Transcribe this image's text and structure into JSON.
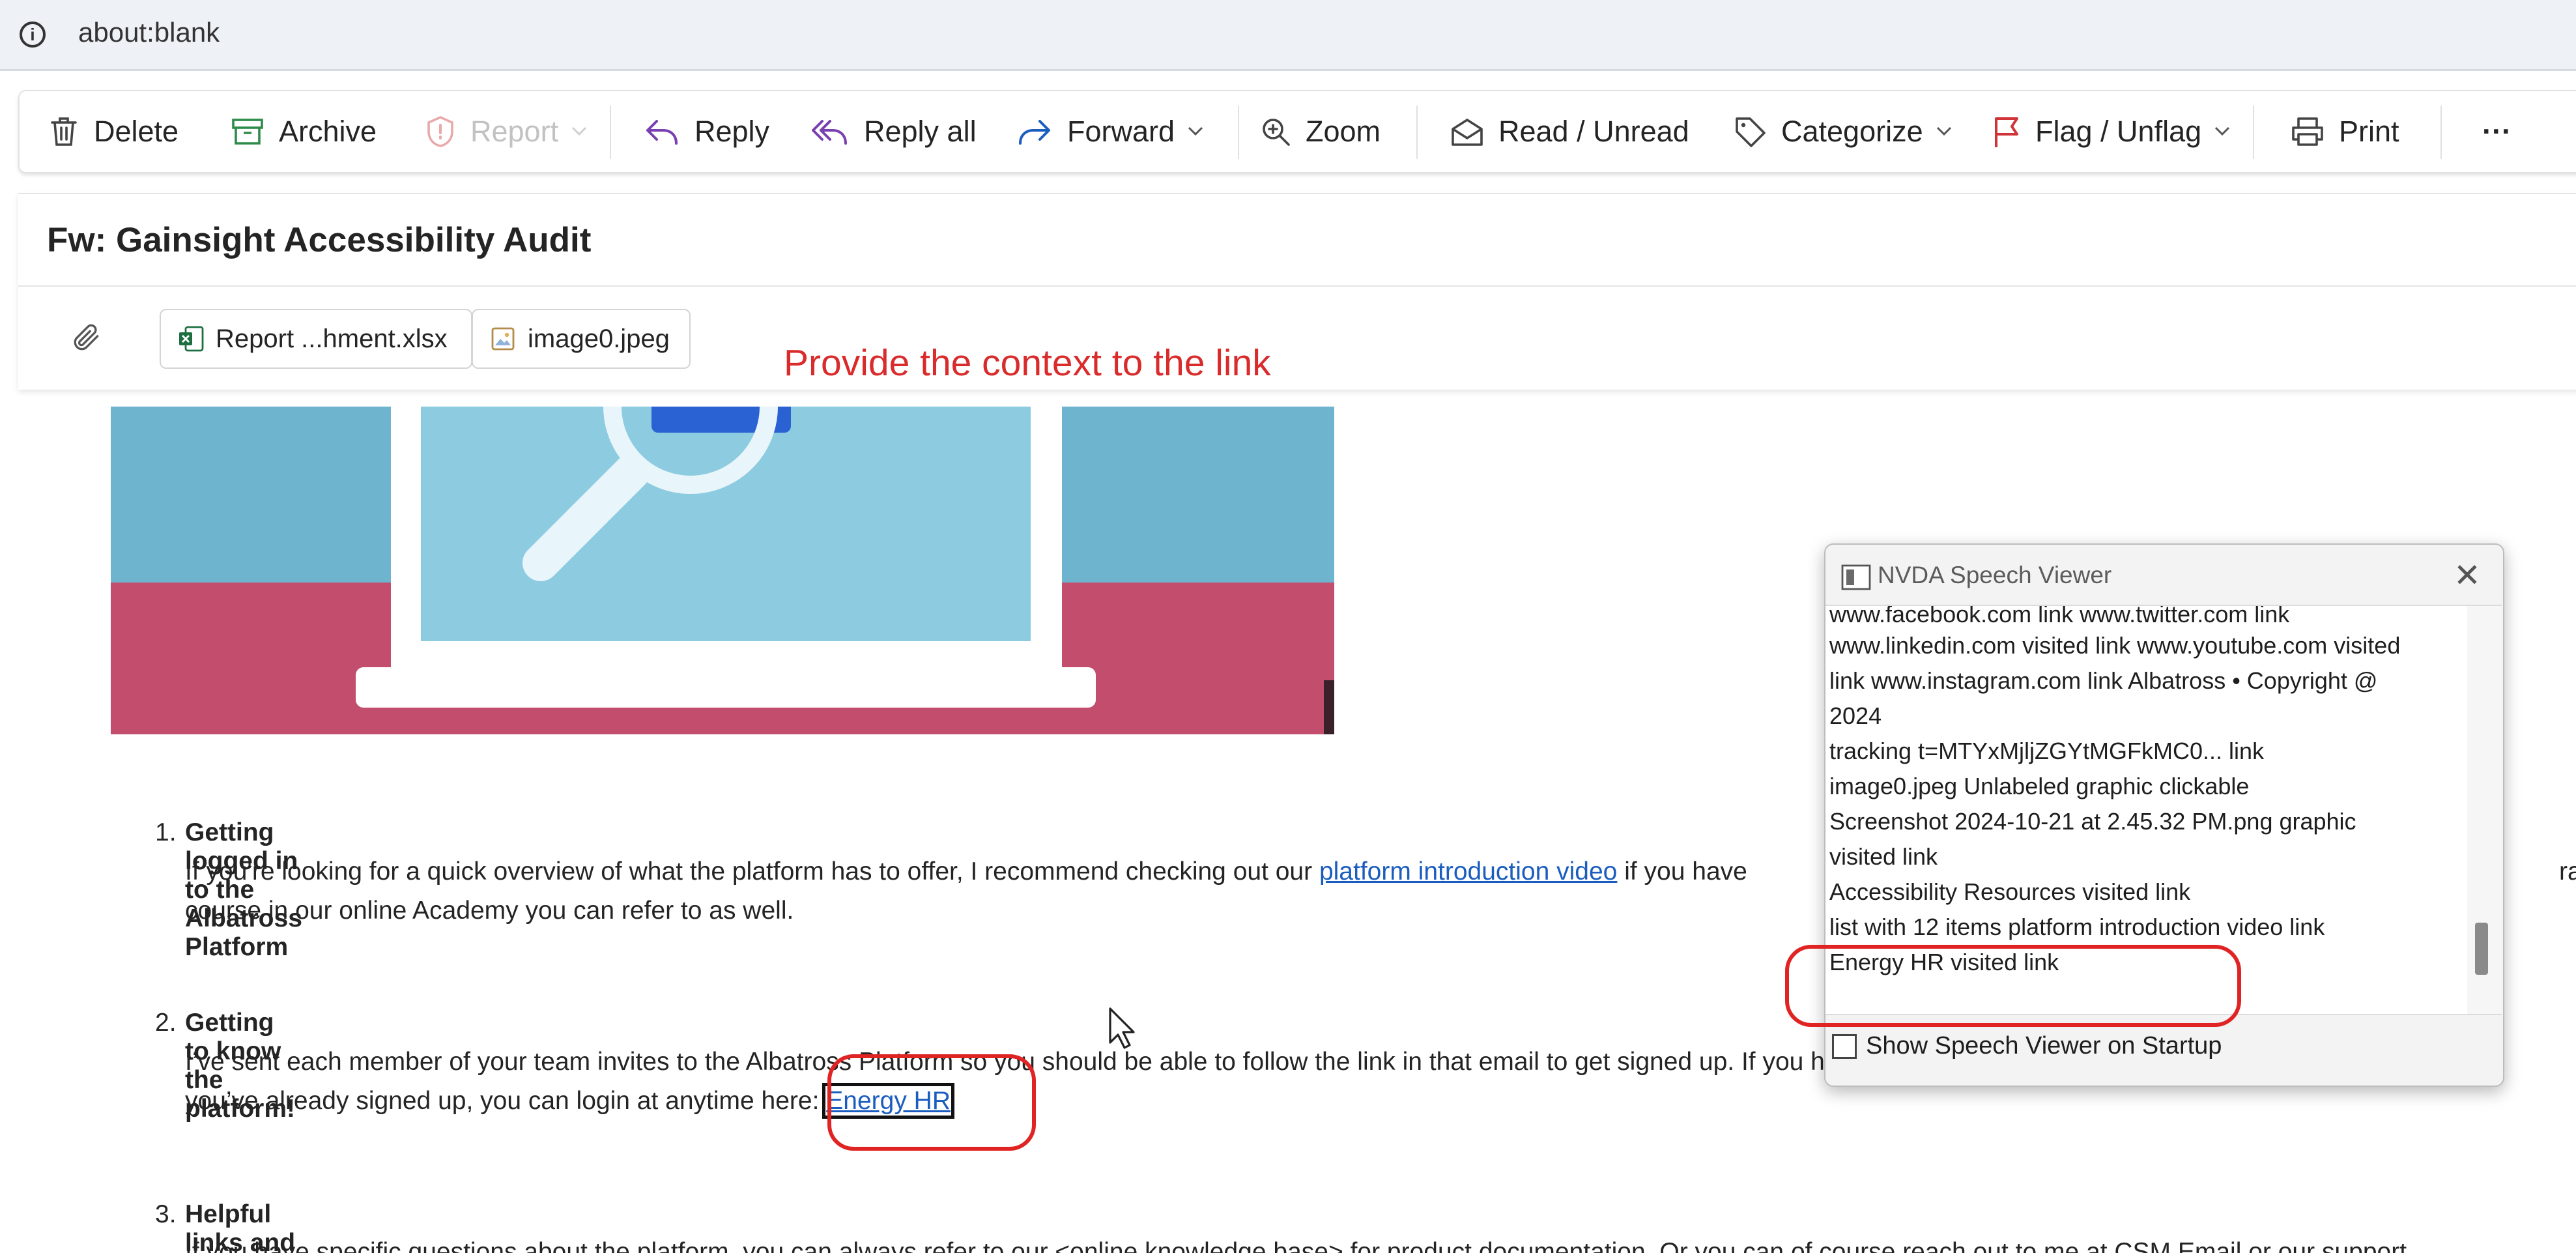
{
  "address_bar": {
    "url": "about:blank"
  },
  "toolbar": {
    "delete": "Delete",
    "archive": "Archive",
    "report": "Report",
    "reply": "Reply",
    "reply_all": "Reply all",
    "forward": "Forward",
    "zoom": "Zoom",
    "read_unread": "Read / Unread",
    "categorize": "Categorize",
    "flag_unflag": "Flag / Unflag",
    "print": "Print",
    "more": "···"
  },
  "email": {
    "subject": "Fw: Gainsight Accessibility Audit",
    "attachments": [
      {
        "name": "Report ...hment.xlsx"
      },
      {
        "name": "image0.jpeg"
      }
    ]
  },
  "annotation": {
    "note": "Provide the context to the link"
  },
  "body": {
    "items": [
      {
        "num": "1.",
        "title": "Getting logged in to the Albatross Platform",
        "line1_pre": "If you're looking for a quick overview of what the platform has to offer, I recommend checking out our ",
        "line1_link": "platform introduction video",
        "line1_post": " if you have",
        "line1_tail": "raining",
        "line2": "course in our online Academy you can refer to as well."
      },
      {
        "num": "2.",
        "title": "Getting to know the platform!",
        "line1": "I’ve sent each member of your team invites to the Albatross Platform so you should be able to follow the link in that email to get signed up. If you haven’t received an email yet, please let me know. If",
        "line2_pre": "you’ve already signed up, you can login at anytime here: ",
        "line2_link": "Energy HR"
      },
      {
        "num": "3.",
        "title": "Helpful links and resources",
        "line1": "If you have specific questions about the platform, you can always refer to our <online knowledge base> for product documentation. Or you can of course reach out to me at CSM Email or our support"
      }
    ]
  },
  "nvda": {
    "title": "NVDA Speech Viewer",
    "close": "✕",
    "lines": [
      "www.facebook.com  link   www.twitter.com  link",
      "www.linkedin.com  visited  link   www.youtube.com  visited",
      "link   www.instagram.com  link   Albatross • Copyright @",
      "2024",
      "tracking t=MTYxMjljZGYtMGFkMC0...  link",
      "image0.jpeg  Unlabeled graphic  clickable",
      "Screenshot 2024-10-21 at 2.45.32 PM.png  graphic",
      "visited  link",
      "Accessibility Resources  visited  link",
      "list  with 12 items  platform introduction video  link",
      "Energy HR  visited  link"
    ],
    "checkbox_label": "Show Speech Viewer on Startup"
  },
  "colors": {
    "annotation_red": "#e02424",
    "link_blue": "#1a5dbf",
    "hero_top": "#6fb4cf",
    "hero_bottom": "#c24d6d"
  }
}
